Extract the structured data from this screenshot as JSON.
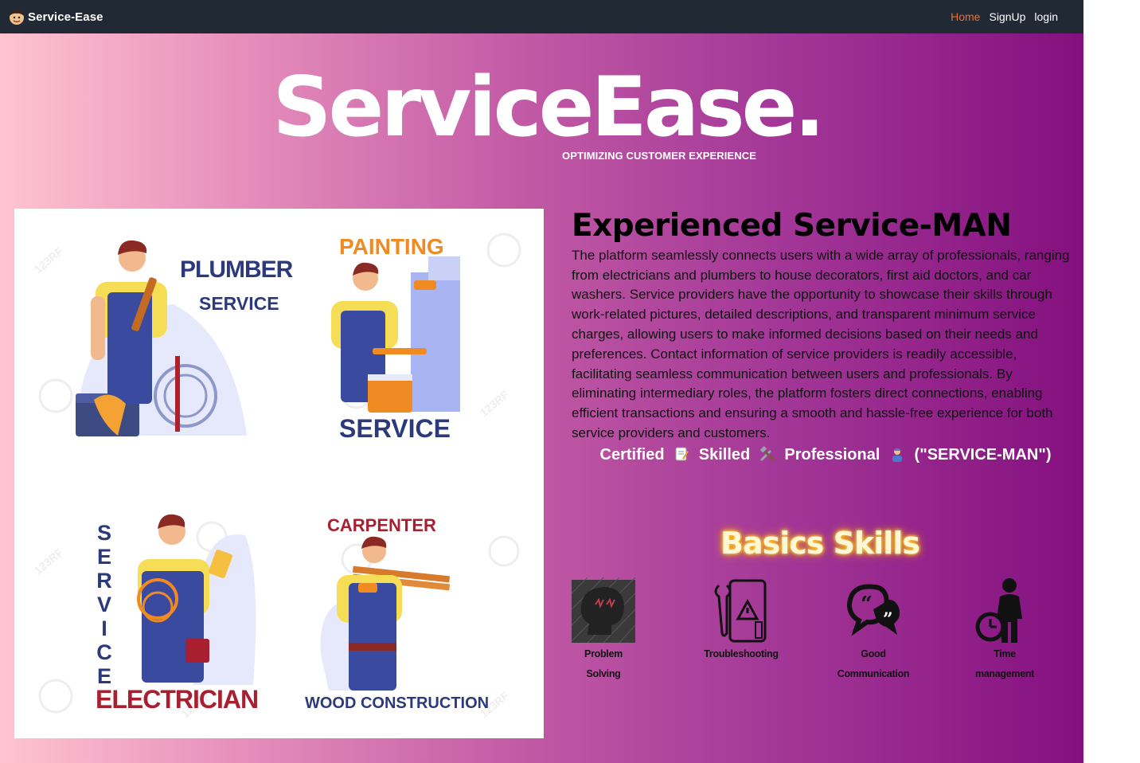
{
  "nav": {
    "brand": "Service-Ease",
    "links": [
      "Home",
      "SignUp",
      "login"
    ]
  },
  "hero": {
    "title": "ServiceEase.",
    "subtitle": "OPTIMIZING CUSTOMER EXPERIENCE"
  },
  "illustration": {
    "panels": [
      {
        "line1": "PLUMBER",
        "line2": "SERVICE"
      },
      {
        "line1": "PAINTING",
        "line2": "SERVICE"
      },
      {
        "vertical": [
          "S",
          "E",
          "R",
          "V",
          "I",
          "C",
          "E"
        ],
        "line1": "ELECTRICIAN"
      },
      {
        "line1": "CARPENTER",
        "line2": "WOOD CONSTRUCTION"
      }
    ],
    "watermark": "123RF"
  },
  "about": {
    "title": "Experienced Service-MAN",
    "body": "The platform seamlessly connects users with a wide array of professionals, ranging from electricians and plumbers to house decorators, first aid doctors, and car washers. Service providers have the opportunity to showcase their skills through work-related pictures, detailed descriptions, and transparent minimum service charges, allowing users to make informed decisions based on their needs and preferences. Contact information of service providers is readily accessible, facilitating seamless communication between users and professionals. By eliminating intermediary roles, the platform fosters direct connections, enabling efficient transactions and ensuring a smooth and hassle-free experience for both service providers and customers.",
    "tagline": {
      "w1": "Certified",
      "w2": "Skilled",
      "w3": "Professional",
      "w4": "(\"SERVICE-MAN\")"
    }
  },
  "skills": {
    "heading": "Basics Skills",
    "items": [
      {
        "line1": "Problem",
        "line2": "Solving",
        "icon": "brain-icon"
      },
      {
        "line1": "Troubleshooting",
        "line2": "",
        "icon": "troubleshooting-icon"
      },
      {
        "line1": "Good",
        "line2": "Communication",
        "icon": "chat-bubbles-icon"
      },
      {
        "line1": "Time",
        "line2": "management",
        "icon": "clock-person-icon"
      }
    ]
  },
  "colors": {
    "navbar": "#212935",
    "nav_active": "#f06a2c",
    "gradient_start": "#ffc4cf",
    "gradient_end": "#84107f",
    "skills_glow": "#ffaa00"
  }
}
